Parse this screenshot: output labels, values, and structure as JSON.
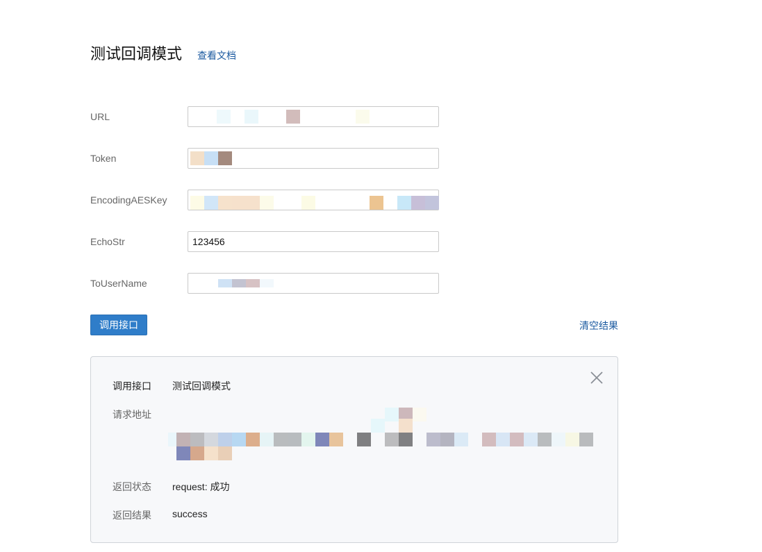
{
  "header": {
    "title": "测试回调模式",
    "doc_link": "查看文档"
  },
  "form": {
    "url": {
      "label": "URL",
      "value": ""
    },
    "token": {
      "label": "Token",
      "value": ""
    },
    "aes_key": {
      "label": "EncodingAESKey",
      "value": ""
    },
    "echo_str": {
      "label": "EchoStr",
      "value": "123456"
    },
    "to_user": {
      "label": "ToUserName",
      "value": ""
    }
  },
  "actions": {
    "call_label": "调用接口",
    "clear_label": "清空结果"
  },
  "result": {
    "interface_key": "调用接口",
    "interface_val": "测试回调模式",
    "address_key": "请求地址",
    "status_key": "返回状态",
    "status_val": "request: 成功",
    "result_key": "返回结果",
    "result_val": "success"
  },
  "colors": {
    "primary_button": "#2f7dc9",
    "link": "#1b5aa0",
    "panel_bg": "#f7f8fa"
  },
  "icons": {
    "close": "close-icon"
  }
}
